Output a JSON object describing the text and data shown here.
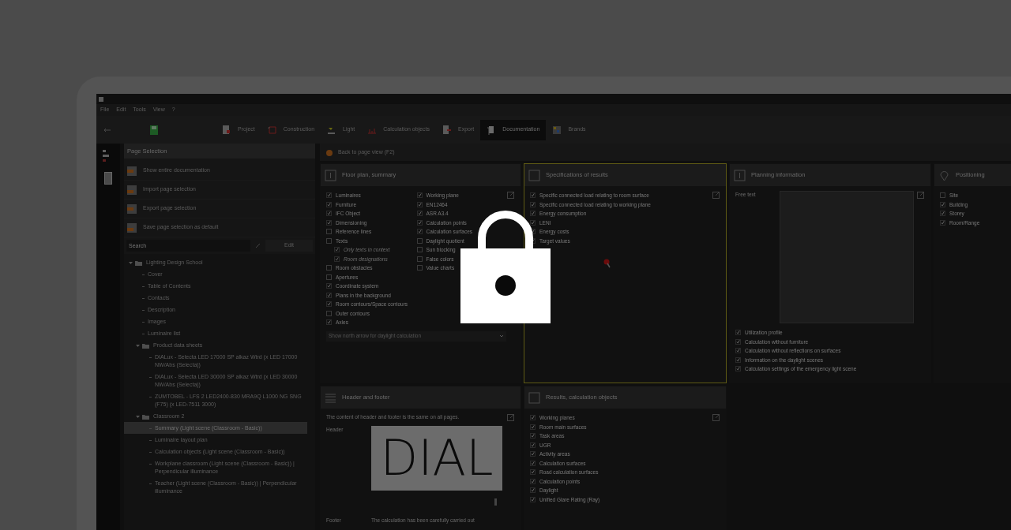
{
  "menu": [
    "File",
    "Edit",
    "Tools",
    "View",
    "?"
  ],
  "toolbar_tabs": [
    {
      "label": "Project",
      "selected": false
    },
    {
      "label": "Construction",
      "selected": false
    },
    {
      "label": "Light",
      "selected": false
    },
    {
      "label": "Calculation objects",
      "selected": false
    },
    {
      "label": "Export",
      "selected": false
    },
    {
      "label": "Documentation",
      "selected": true
    },
    {
      "label": "Brands",
      "selected": false
    }
  ],
  "page_selection": {
    "title": "Page Selection",
    "actions": [
      "Show entire documentation",
      "Import page selection",
      "Export page selection",
      "Save page selection as default"
    ],
    "search": {
      "placeholder": "Search"
    },
    "edit_button": "Edit",
    "tree": [
      {
        "label": "Lighting Design School",
        "kind": "folder",
        "expanded": true,
        "selected": false,
        "children": [
          {
            "label": "Cover",
            "kind": "page",
            "selected": false
          },
          {
            "label": "Table of Contents",
            "kind": "page",
            "selected": false
          },
          {
            "label": "Contacts",
            "kind": "page",
            "selected": false
          },
          {
            "label": "Description",
            "kind": "page",
            "selected": false
          },
          {
            "label": "Images",
            "kind": "page",
            "selected": false
          },
          {
            "label": "Luminaire list",
            "kind": "page",
            "selected": false
          },
          {
            "label": "Product data sheets",
            "kind": "folder",
            "expanded": true,
            "selected": false,
            "children": [
              {
                "label": "DIALux - Selecta LED 17000 SP alkaz Wtrd (x LED 17000 NW/Abs (Selecta))",
                "kind": "page",
                "selected": false
              },
              {
                "label": "DIALux - Selecta LED 30000 SP alkaz Wtrd (x LED 30000 NW/Abs (Selecta))",
                "kind": "page",
                "selected": false
              },
              {
                "label": "ZUMTOBEL - LFS 2 LED2400-830 MRA9Q L1000 NG SNG (F75) (x LED-7511 3000)",
                "kind": "page",
                "selected": false
              }
            ]
          },
          {
            "label": "Classroom 2",
            "kind": "folder",
            "expanded": true,
            "selected": false,
            "children": [
              {
                "label": "Summary (Light scene (Classroom - Basic))",
                "kind": "page",
                "selected": true
              },
              {
                "label": "Luminaire layout plan",
                "kind": "page",
                "selected": false
              },
              {
                "label": "Calculation objects (Light scene (Classroom - Basic))",
                "kind": "page",
                "selected": false
              },
              {
                "label": "Workplane classroom (Light scene (Classroom - Basic)) | Perpendicular illuminance",
                "kind": "page",
                "selected": false
              },
              {
                "label": "Teacher (Light scene (Classroom - Basic)) | Perpendicular illuminance",
                "kind": "page",
                "selected": false
              }
            ]
          }
        ]
      }
    ]
  },
  "back_link": "Back to page view (F2)",
  "cards": [
    {
      "kind": "options",
      "title": "Floor plan, summary",
      "highlighted": false,
      "columns": [
        [
          {
            "label": "Luminaires",
            "checked": true
          },
          {
            "label": "Furniture",
            "checked": true
          },
          {
            "label": "IFC Object",
            "checked": true
          },
          {
            "label": "Dimensioning",
            "checked": true
          },
          {
            "label": "Reference lines",
            "checked": false
          },
          {
            "label": "Texts",
            "checked": false,
            "children": [
              {
                "label": "Only texts in context",
                "checked": true,
                "disabled": true
              },
              {
                "label": "Room designations",
                "checked": true,
                "disabled": true
              }
            ]
          },
          {
            "label": "Room obstacles",
            "checked": false
          },
          {
            "label": "Apertures",
            "checked": false
          },
          {
            "label": "Coordinate system",
            "checked": true
          },
          {
            "label": "Plans in the background",
            "checked": true
          },
          {
            "label": "Room contours/Space contours",
            "checked": true
          },
          {
            "label": "Outer contours",
            "checked": false
          },
          {
            "label": "Axles",
            "checked": true
          }
        ],
        [
          {
            "label": "Working plane",
            "checked": true
          },
          {
            "label": "EN12464",
            "checked": true
          },
          {
            "label": "ASR A3.4",
            "checked": true
          },
          {
            "label": "Calculation points",
            "checked": true
          },
          {
            "label": "Calculation surfaces",
            "checked": true
          },
          {
            "label": "Daylight quotient",
            "checked": false
          },
          {
            "label": "Sun blocking",
            "checked": false
          },
          {
            "label": "False colors",
            "checked": false
          },
          {
            "label": "Value charts",
            "checked": false
          }
        ]
      ],
      "dropdown": "Show north arrow for daylight calculation"
    },
    {
      "kind": "options",
      "title": "Specifications of results",
      "highlighted": true,
      "columns": [
        [
          {
            "label": "Specific connected load relating to room surface",
            "checked": true
          },
          {
            "label": "Specific connected load relating to working plane",
            "checked": true
          },
          {
            "label": "Energy consumption",
            "checked": true
          },
          {
            "label": "LENI",
            "checked": true
          },
          {
            "label": "Energy costs",
            "checked": true
          },
          {
            "label": "Target values",
            "checked": true
          }
        ]
      ]
    },
    {
      "kind": "planning",
      "title": "Planning information",
      "highlighted": false,
      "free_text_label": "Free text",
      "columns": [
        [
          {
            "label": "Utilization profile",
            "checked": true
          },
          {
            "label": "Calculation without furniture",
            "checked": true
          },
          {
            "label": "Calculation without reflections on surfaces",
            "checked": true
          },
          {
            "label": "Information on the daylight scenes",
            "checked": true
          },
          {
            "label": "Calculation settings of the emergency light scene",
            "checked": true
          }
        ]
      ]
    },
    {
      "kind": "options",
      "title": "Positioning",
      "highlighted": false,
      "columns": [
        [
          {
            "label": "Site",
            "checked": false
          },
          {
            "label": "Building",
            "checked": true
          },
          {
            "label": "Storey",
            "checked": true
          },
          {
            "label": "Room/Range",
            "checked": true
          }
        ]
      ]
    },
    {
      "kind": "header_footer",
      "title": "Header and footer",
      "highlighted": false,
      "note": "The content of header and footer is the same on all pages.",
      "header_label": "Header",
      "logo": "DIAL",
      "footer_label": "Footer",
      "footer_text": "The calculation has been carefully carried out"
    },
    {
      "kind": "options",
      "title": "Results, calculation objects",
      "highlighted": false,
      "columns": [
        [
          {
            "label": "Working planes",
            "checked": true
          },
          {
            "label": "Room main surfaces",
            "checked": true
          },
          {
            "label": "Task areas",
            "checked": true
          },
          {
            "label": "UGR",
            "checked": true
          },
          {
            "label": "Activity areas",
            "checked": true
          },
          {
            "label": "Calculation surfaces",
            "checked": true
          },
          {
            "label": "Road calculation surfaces",
            "checked": true
          },
          {
            "label": "Calculation points",
            "checked": true
          },
          {
            "label": "Daylight",
            "checked": true
          },
          {
            "label": "Unified Glare Rating (Ray)",
            "checked": true
          }
        ]
      ]
    }
  ]
}
